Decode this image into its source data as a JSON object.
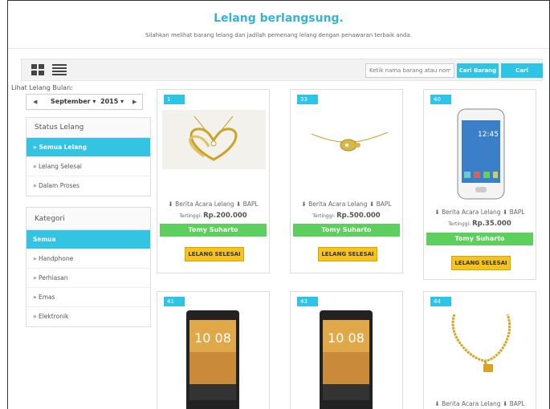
{
  "header": {
    "title": "Lelang berlangsung.",
    "subtitle": "Silahkan melihat barang lelang dan jadilah pemenang lelang dengan penawaran terbaik anda."
  },
  "toolbar": {
    "search_placeholder": "Ketik nama barang atau nomor",
    "search_button": "Cari Barang",
    "transaction_button": "Cari Transaksi"
  },
  "sidebar": {
    "month_label": "Lihat Lelang Bulan:",
    "month_value": "September",
    "year_value": "2015",
    "prev_glyph": "◀",
    "next_glyph": "▶",
    "status_title": "Status Lelang",
    "status_items": [
      "» Semua Lelang",
      "» Lelang Selesai",
      "» Dalam Proses"
    ],
    "category_title": "Kategori",
    "category_items": [
      "Semua",
      "» Handphone",
      "» Perhiasan",
      "» Emas",
      "» Elektronik"
    ]
  },
  "cards": [
    {
      "id": "1",
      "product": "gold-heart-necklace",
      "links": "⬇ Berita Acara Lelang  ⬇ BAPL",
      "price_label": "Tertinggi:",
      "price": "Rp.200.000",
      "winner": "Tomy Suharto",
      "status": "LELANG SELESAI"
    },
    {
      "id": "33",
      "product": "gold-turtle-necklace",
      "links": "⬇ Berita Acara Lelang  ⬇ BAPL",
      "price_label": "Tertinggi:",
      "price": "Rp.500.000",
      "winner": "Tomy Suharto",
      "status": "LELANG SELESAI"
    },
    {
      "id": "40",
      "product": "samsung-phone",
      "links": "⬇ Berita Acara Lelang  ⬇ BAPL",
      "price_label": "Tertinggi:",
      "price": "Rp.35.000",
      "winner": "Tomy Suharto",
      "status": "LELANG SELESAI"
    },
    {
      "id": "41",
      "product": "htc-phone",
      "clock": "10 08"
    },
    {
      "id": "43",
      "product": "htc-phone",
      "clock": "10 08"
    },
    {
      "id": "44",
      "product": "gold-chain-necklace",
      "links": "⬇ Berita Acara Lelang  ⬇ BAPL"
    }
  ],
  "colors": {
    "accent": "#2ec4e6",
    "winner": "#5ccf5c",
    "status": "#f6c21c"
  }
}
